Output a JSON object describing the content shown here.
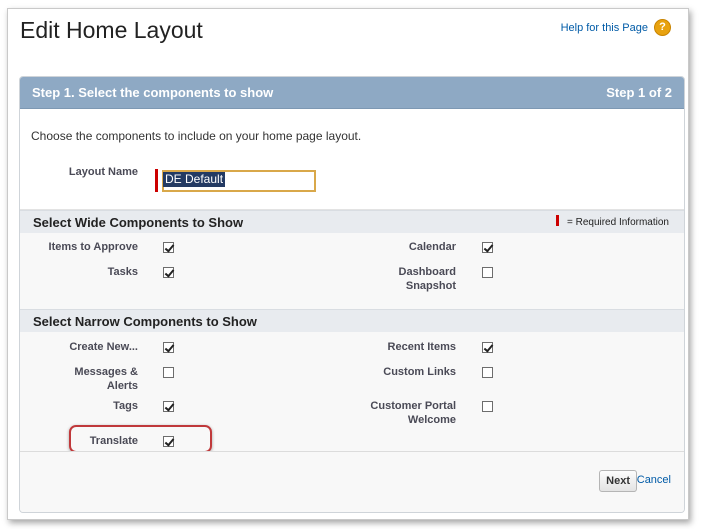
{
  "page": {
    "title": "Edit Home Layout",
    "help_link": "Help for this Page",
    "help_icon": "?"
  },
  "step": {
    "title": "Step 1. Select the components to show",
    "count": "Step 1 of 2"
  },
  "intro": "Choose the components to include on your home page layout.",
  "layout_name": {
    "label": "Layout Name",
    "value": "DE Default"
  },
  "wide_section": {
    "title": "Select Wide Components to Show",
    "required_legend": "= Required Information",
    "items": [
      {
        "label": "Items to Approve",
        "checked": true
      },
      {
        "label": "Tasks",
        "checked": true
      },
      {
        "label": "Calendar",
        "checked": true
      },
      {
        "label": "Dashboard Snapshot",
        "checked": false
      }
    ]
  },
  "narrow_section": {
    "title": "Select Narrow Components to Show",
    "items": [
      {
        "label": "Create New...",
        "checked": true
      },
      {
        "label": "Messages & Alerts",
        "checked": false
      },
      {
        "label": "Tags",
        "checked": true
      },
      {
        "label": "Translate",
        "checked": true
      },
      {
        "label": "Recent Items",
        "checked": true
      },
      {
        "label": "Custom Links",
        "checked": false
      },
      {
        "label": "Customer Portal Welcome",
        "checked": false
      }
    ]
  },
  "buttons": {
    "next": "Next",
    "cancel": "Cancel"
  },
  "colors": {
    "header_bg": "#8ea9c4",
    "link": "#015ba7",
    "required": "#cc0000",
    "highlight": "#c0393b"
  }
}
